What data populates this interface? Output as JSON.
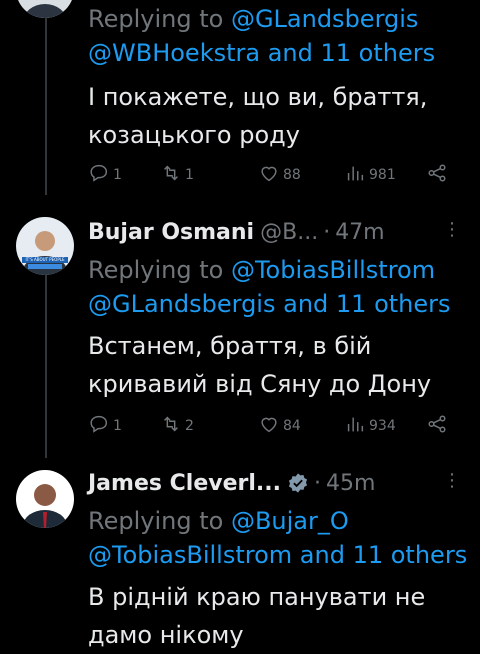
{
  "tweets": [
    {
      "reply_prefix": "Replying to ",
      "reply_line1_link": "@GLandsbergis",
      "reply_line2_link": "@WBHoekstra",
      "reply_line2_rest": " and 11 others",
      "text_line1": "І покажете, що ви, браття,",
      "text_line2": "козацького роду",
      "replies": "1",
      "retweets": "1",
      "likes": "88",
      "views": "981"
    },
    {
      "name": "Bujar Osmani",
      "handle": "@B...",
      "sep": "·",
      "time": "47m",
      "reply_prefix": "Replying to ",
      "reply_line1_link": "@TobiasBillstrom",
      "reply_line2_link": "@GLandsbergis",
      "reply_line2_rest": " and 11 others",
      "text_line1": "Встанем, браття, в бій",
      "text_line2": "кривавий від Сяну до Дону",
      "replies": "1",
      "retweets": "2",
      "likes": "84",
      "views": "934",
      "avatar_caption": "IT'S ABOUT PEOPLE"
    },
    {
      "name": "James Cleverl...",
      "sep": "·",
      "time": "45m",
      "reply_prefix": "Replying to ",
      "reply_line1_link": "@Bujar_O",
      "reply_line2_link": "@TobiasBillstrom",
      "reply_line2_rest": " and 11 others",
      "text_line1": "В рідній краю панувати не",
      "text_line2": "дамо нікому"
    }
  ],
  "colors": {
    "background": "#000000",
    "text": "#e7e9ea",
    "muted": "#71767b",
    "link": "#1d9bf0",
    "verified_gray": "#829aab"
  }
}
